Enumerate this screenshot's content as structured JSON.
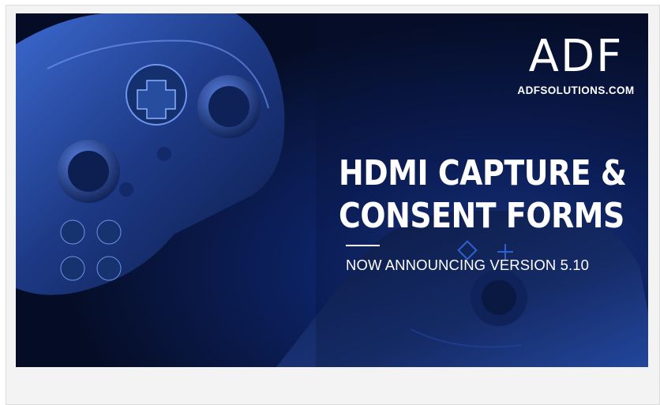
{
  "logo": {
    "letters": "ADF",
    "url": "ADFSOLUTIONS.COM"
  },
  "headline": {
    "line1": "HDMI CAPTURE &",
    "line2": "CONSENT FORMS"
  },
  "subline": "NOW ANNOUNCING VERSION 5.10",
  "colors": {
    "background_dark": "#081634",
    "accent_blue": "#2a6cff",
    "text": "#ffffff"
  },
  "icons": [
    "game-controller-left-icon",
    "game-controller-right-icon"
  ]
}
